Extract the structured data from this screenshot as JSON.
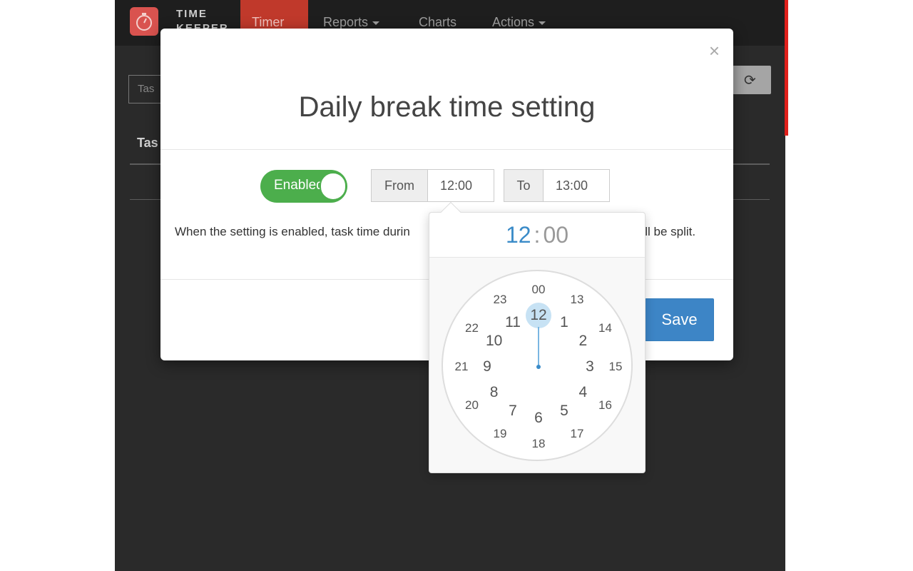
{
  "colors": {
    "nav_active": "#c0392b",
    "toggle_on": "#4cae4c",
    "primary": "#3d85c6",
    "accent_time": "#3a8bc8"
  },
  "navbar": {
    "brand_line1": "TIME",
    "brand_line2": "KEEPER",
    "items": [
      {
        "label": "Timer",
        "active": true
      },
      {
        "label": "Reports",
        "dropdown": true
      },
      {
        "label": "Charts"
      },
      {
        "label": "Actions",
        "dropdown": true
      }
    ],
    "logo_icon": "stopwatch-icon"
  },
  "background": {
    "task_input_placeholder": "Tas",
    "table_header_task": "Tas",
    "refresh_icon": "refresh-icon"
  },
  "modal": {
    "close_symbol": "×",
    "title": "Daily break time setting",
    "toggle_label": "Enabled",
    "toggle_on": true,
    "from_label": "From",
    "from_value": "12:00",
    "to_label": "To",
    "to_value": "13:00",
    "description_left": "When the setting is enabled, task time durin",
    "description_right": "r will be split.",
    "save_label": "Save"
  },
  "clock": {
    "hours_display": "12",
    "separator": ":",
    "minutes_display": "00",
    "selected": "12",
    "inner_ticks": [
      "12",
      "1",
      "2",
      "3",
      "4",
      "5",
      "6",
      "7",
      "8",
      "9",
      "10",
      "11"
    ],
    "outer_ticks": [
      "00",
      "13",
      "14",
      "15",
      "16",
      "17",
      "18",
      "19",
      "20",
      "21",
      "22",
      "23"
    ]
  }
}
